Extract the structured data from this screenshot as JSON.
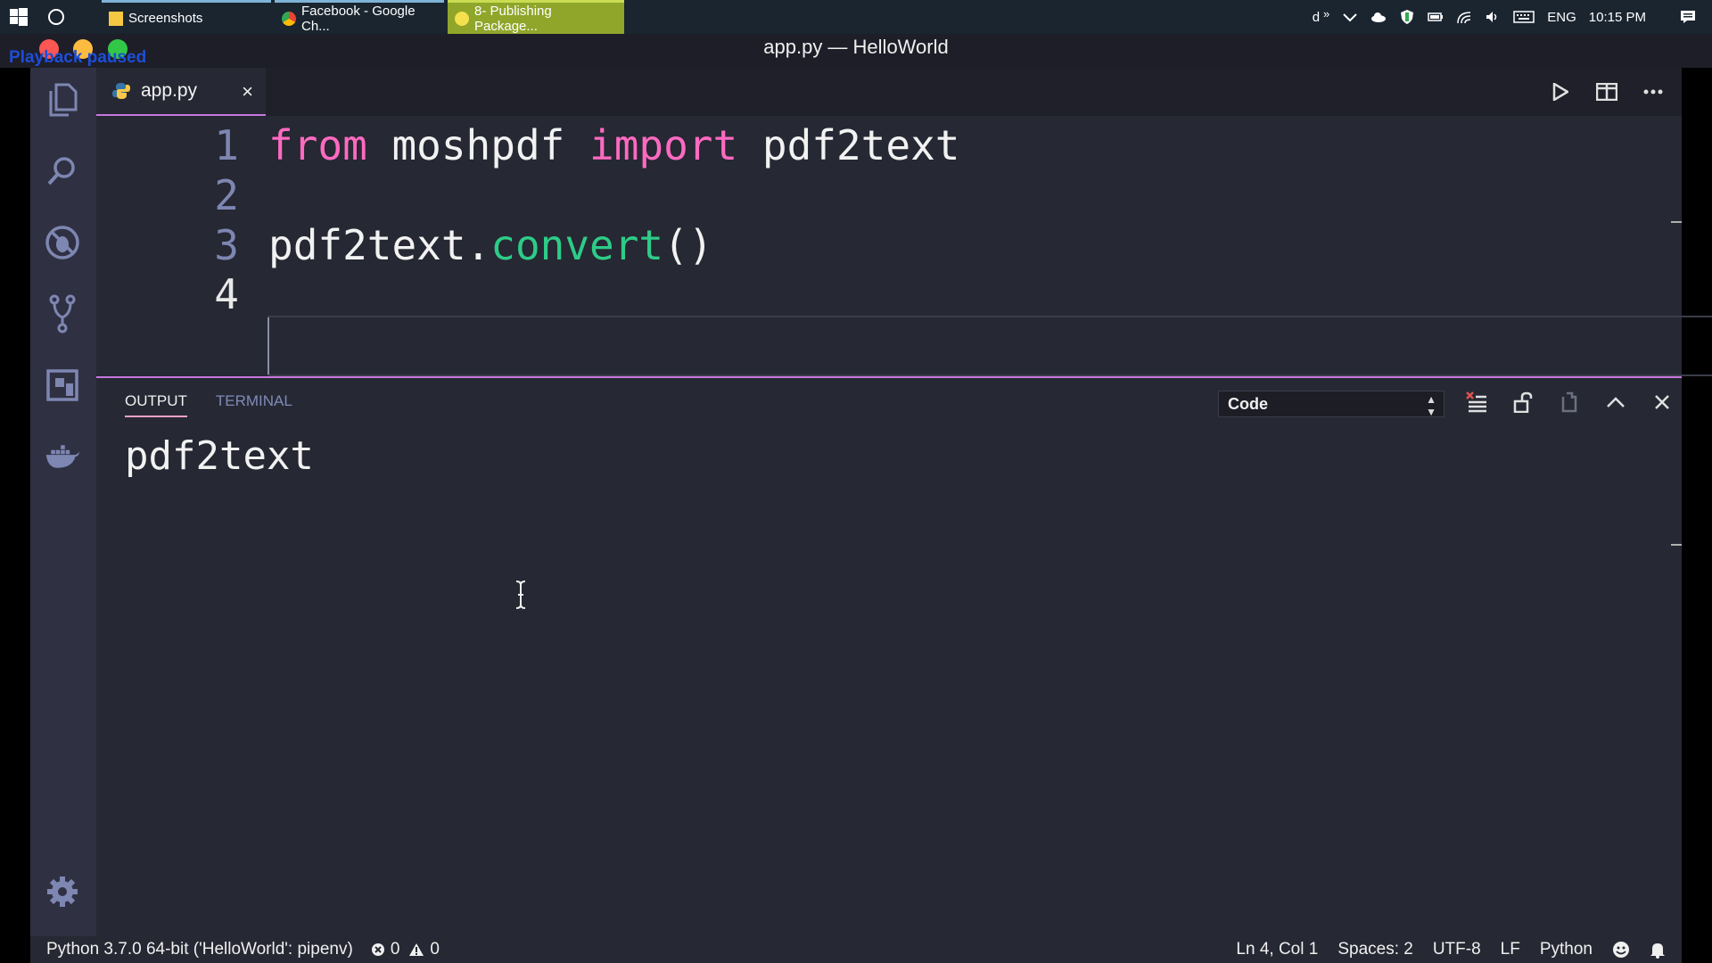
{
  "taskbar": {
    "tasks": [
      {
        "label": "Screenshots"
      },
      {
        "label": "Facebook - Google Ch..."
      },
      {
        "label": "8- Publishing Package..."
      }
    ],
    "tray_user": "d",
    "tray_chevron": "»",
    "language": "ENG",
    "time": "10:15 PM"
  },
  "window": {
    "title": "app.py — HelloWorld",
    "overlay_text": "Playback paused"
  },
  "editor": {
    "tab_label": "app.py",
    "tab_close": "×",
    "lines": [
      {
        "num": "1",
        "kw1": "from",
        "mid": " moshpdf ",
        "kw2": "import",
        "rest": " pdf2text"
      },
      {
        "num": "2"
      },
      {
        "num": "3",
        "obj": "pdf2text.",
        "method": "convert",
        "parens": "()"
      },
      {
        "num": "4"
      }
    ]
  },
  "panel": {
    "tabs": [
      "OUTPUT",
      "TERMINAL"
    ],
    "active_tab": "OUTPUT",
    "channel_select": "Code",
    "output_text": "pdf2text"
  },
  "statusbar": {
    "interpreter": "Python 3.7.0 64-bit ('HelloWorld': pipenv)",
    "errors": "0",
    "warnings": "0",
    "position": "Ln 4, Col 1",
    "spaces": "Spaces: 2",
    "encoding": "UTF-8",
    "eol": "LF",
    "language": "Python"
  },
  "colors": {
    "accent": "#c678dd",
    "keyword": "#ff6ac1",
    "function": "#2ecc87",
    "line_number": "#7e86b2",
    "editor_bg": "#262833"
  },
  "icons": [
    "windows-icon",
    "cortana-icon",
    "files-icon",
    "search-icon",
    "debug-icon",
    "source-control-icon",
    "extensions-icon",
    "docker-icon",
    "settings-icon",
    "run-icon",
    "split-editor-icon",
    "more-icon",
    "clear-output-icon",
    "lock-icon",
    "open-log-icon",
    "maximize-panel-icon",
    "close-panel-icon",
    "python-file-icon",
    "error-icon",
    "warning-icon",
    "feedback-icon",
    "bell-icon"
  ]
}
